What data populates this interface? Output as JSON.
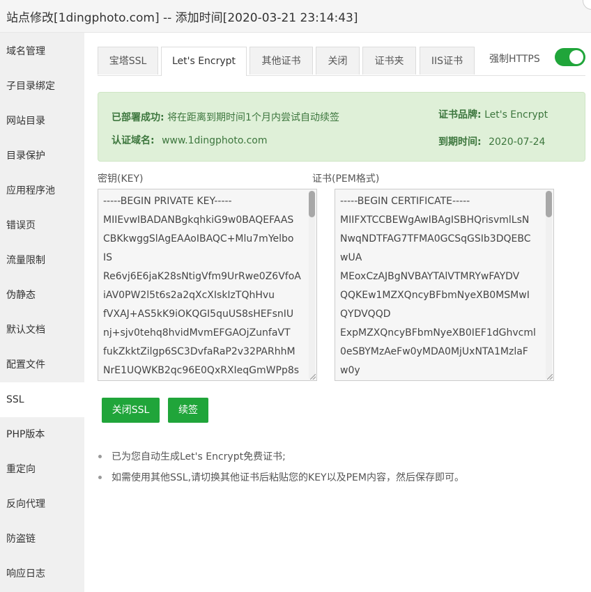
{
  "window": {
    "title": "站点修改[1dingphoto.com] -- 添加时间[2020-03-21 23:14:43]"
  },
  "sidebar": {
    "items": [
      {
        "label": "域名管理"
      },
      {
        "label": "子目录绑定"
      },
      {
        "label": "网站目录"
      },
      {
        "label": "目录保护"
      },
      {
        "label": "应用程序池"
      },
      {
        "label": "错误页"
      },
      {
        "label": "流量限制"
      },
      {
        "label": "伪静态"
      },
      {
        "label": "默认文档"
      },
      {
        "label": "配置文件"
      },
      {
        "label": "SSL"
      },
      {
        "label": "PHP版本"
      },
      {
        "label": "重定向"
      },
      {
        "label": "反向代理"
      },
      {
        "label": "防盗链"
      },
      {
        "label": "响应日志"
      }
    ],
    "active": "SSL"
  },
  "tabs": [
    {
      "label": "宝塔SSL"
    },
    {
      "label": "Let's Encrypt"
    },
    {
      "label": "其他证书"
    },
    {
      "label": "关闭"
    },
    {
      "label": "证书夹"
    },
    {
      "label": "IIS证书"
    }
  ],
  "active_tab": "Let's Encrypt",
  "force_https": {
    "label": "强制HTTPS",
    "enabled": true
  },
  "status": {
    "deployed_key": "已部署成功:",
    "deployed_value": "将在距离到期时间1个月内尝试自动续签",
    "domain_key": "认证域名:",
    "domain_value": "www.1dingphoto.com",
    "brand_key": "证书品牌:",
    "brand_value": "Let's Encrypt",
    "expire_key": "到期时间:",
    "expire_value": "2020-07-24"
  },
  "key_field": {
    "label": "密钥(KEY)",
    "lines": [
      "-----BEGIN PRIVATE KEY-----",
      "MIIEvwIBADANBgkqhkiG9w0BAQEFAAS",
      "CBKkwggSlAgEAAoIBAQC+Mlu7mYelbo",
      "IS",
      "Re6vj6E6jaK28sNtigVfm9UrRwe0Z6VfoA",
      "iAV0PW2l5t6s2a2qXcXIskIzTQhHvu",
      "fVXAJ+AS5kK9iOKQGI5quUS8sHEFsnIU",
      "nj+sjv0tehq8hvidMvmEFGAOjZunfaVT",
      "fukZkktZilgp6SC3DvfaRaP2v32PARhhM",
      "NrE1UQWKB2qc96E0QxRXIeqGmWPp8s"
    ]
  },
  "cert_field": {
    "label": "证书(PEM格式)",
    "lines": [
      "-----BEGIN CERTIFICATE-----",
      "MIIFXTCCBEWgAwIBAgISBHQrisvmlLsN",
      "NwqNDTFAG7TFMA0GCSqGSIb3DQEBC",
      "wUA",
      "MEoxCzAJBgNVBAYTAlVTMRYwFAYDV",
      "QQKEw1MZXQncyBFbmNyeXB0MSMwI",
      "QYDVQQD",
      "ExpMZXQncyBFbmNyeXB0IEF1dGhvcml",
      "0eSBYMzAeFw0yMDA0MjUxNTA1MzlaF",
      "w0y"
    ]
  },
  "buttons": {
    "close_ssl": "关闭SSL",
    "renew": "续签"
  },
  "notes": [
    "已为您自动生成Let's Encrypt免费证书;",
    "如需使用其他SSL,请切换其他证书后粘贴您的KEY以及PEM内容，然后保存即可。"
  ],
  "colors": {
    "accent": "#20a53a",
    "success_bg": "#dff0d8",
    "success_text": "#3c763d"
  }
}
